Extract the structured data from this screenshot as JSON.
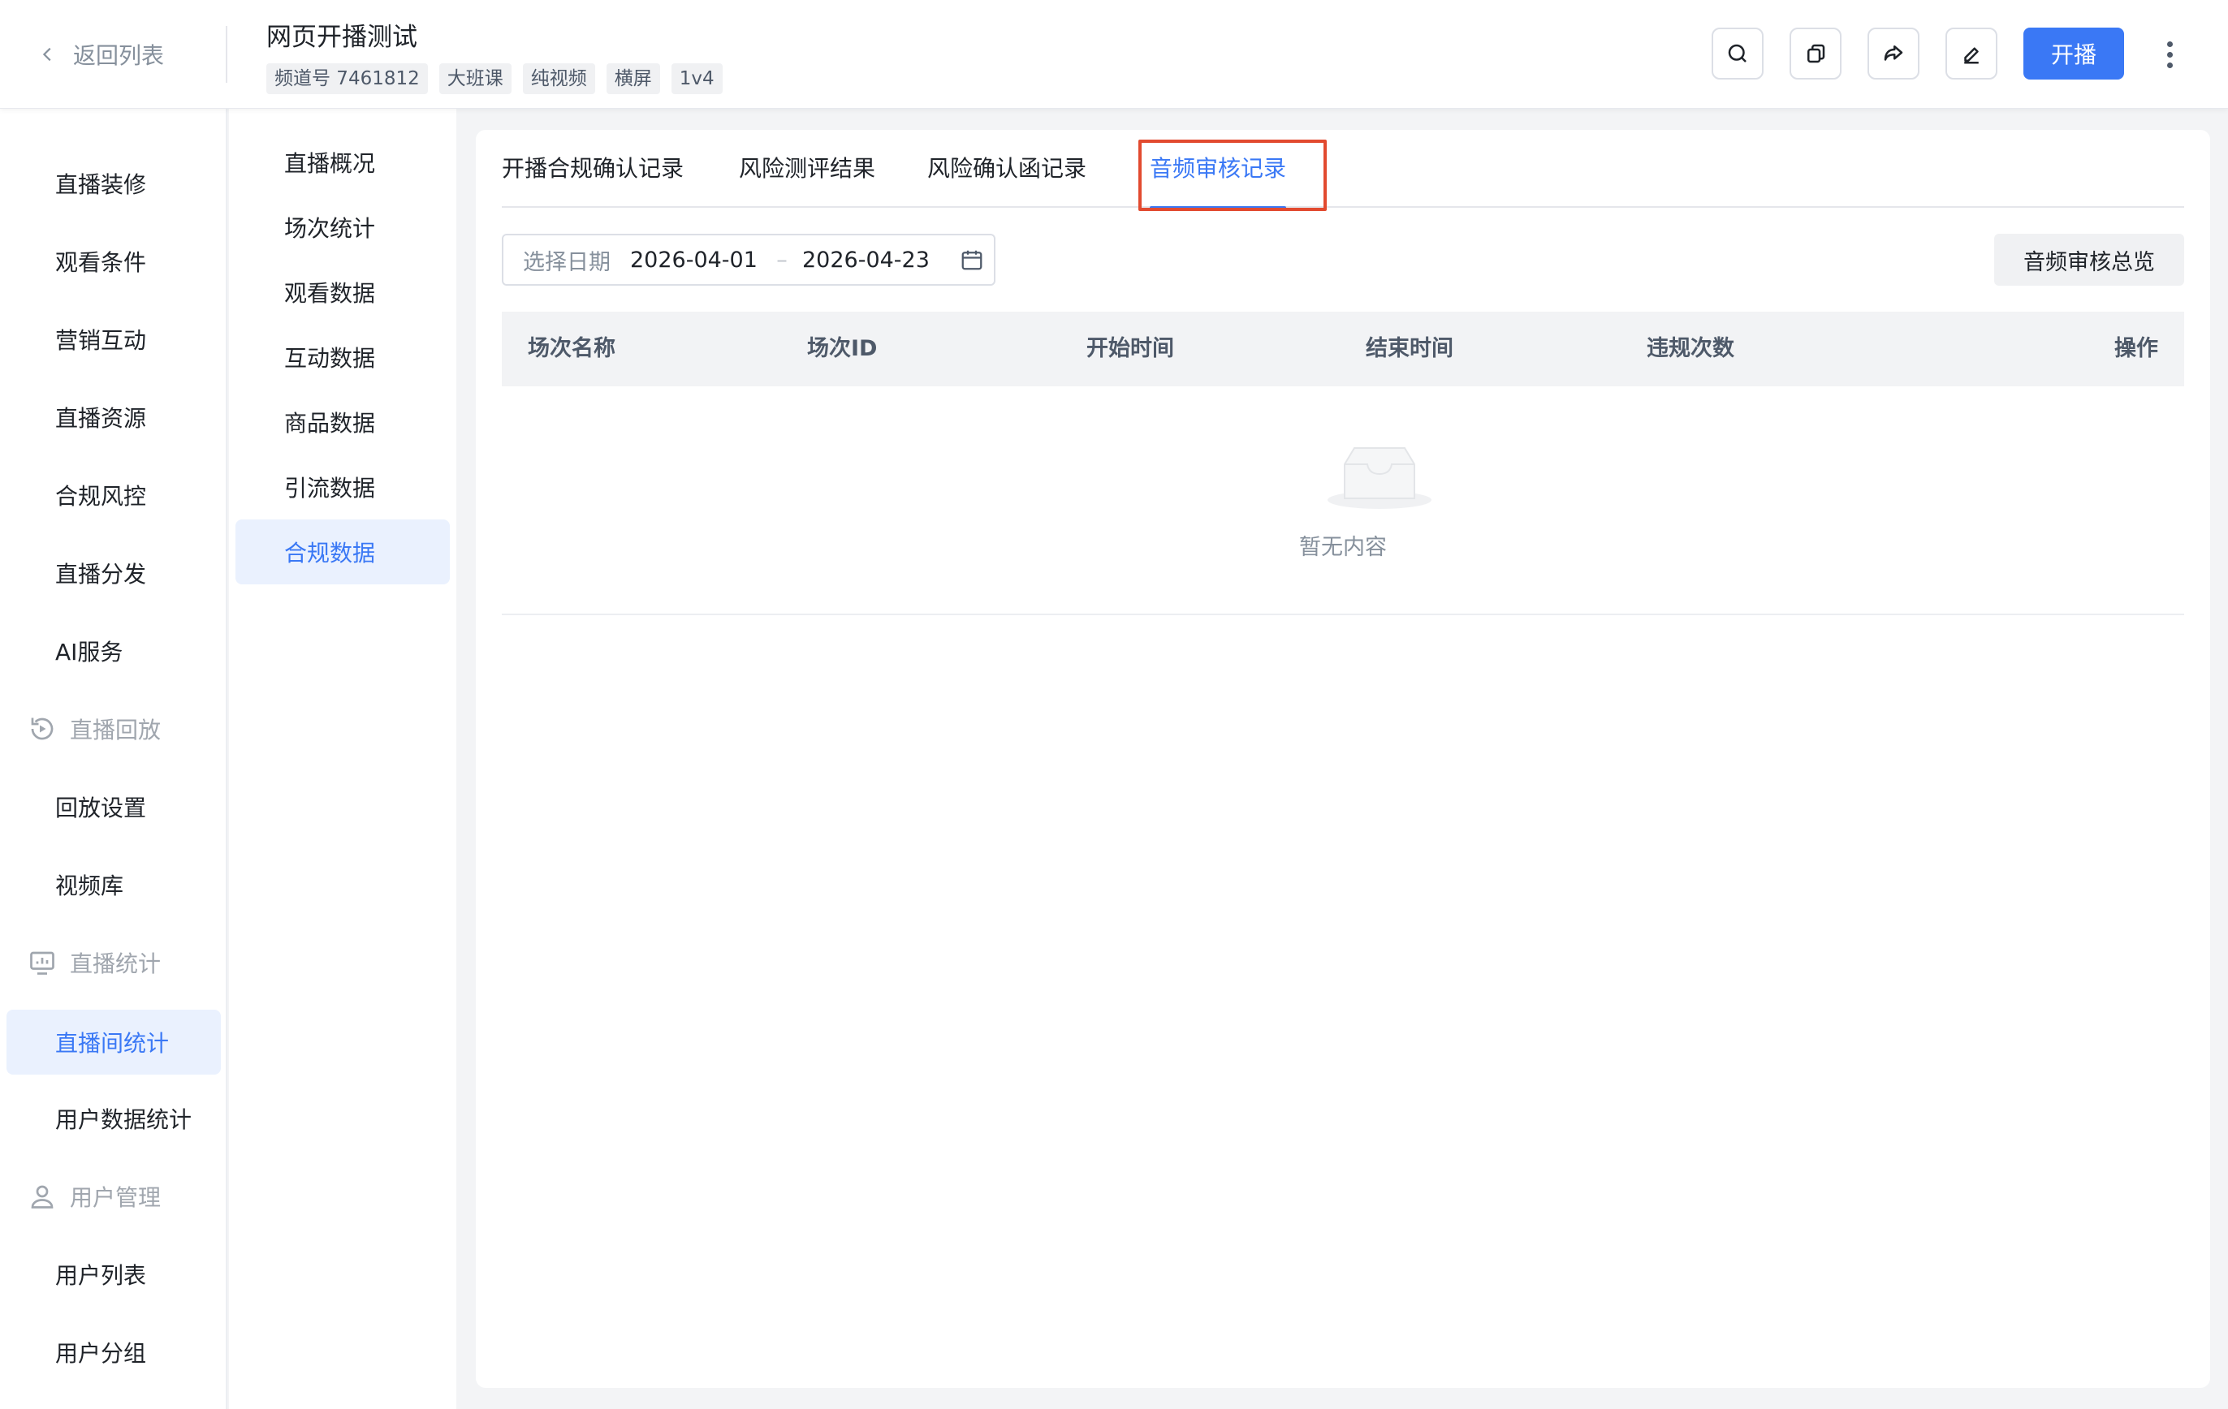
{
  "header": {
    "back_label": "返回列表",
    "title": "网页开播测试",
    "tags": [
      "频道号 7461812",
      "大班课",
      "纯视频",
      "横屏",
      "1v4"
    ],
    "start_label": "开播",
    "accent_color": "#3a78f5"
  },
  "sidebar": {
    "items": [
      {
        "label": "直播装修"
      },
      {
        "label": "观看条件"
      },
      {
        "label": "营销互动"
      },
      {
        "label": "直播资源"
      },
      {
        "label": "合规风控"
      },
      {
        "label": "直播分发"
      },
      {
        "label": "AI服务"
      }
    ],
    "group_replay": {
      "label": "直播回放",
      "icon": "replay-icon"
    },
    "replay_items": [
      {
        "label": "回放设置"
      },
      {
        "label": "视频库"
      }
    ],
    "group_stats": {
      "label": "直播统计",
      "icon": "monitor-chart-icon"
    },
    "stats_items": [
      {
        "label": "直播间统计",
        "active": true
      },
      {
        "label": "用户数据统计"
      }
    ],
    "group_users": {
      "label": "用户管理",
      "icon": "user-icon"
    },
    "user_items": [
      {
        "label": "用户列表"
      },
      {
        "label": "用户分组"
      }
    ]
  },
  "subnav": {
    "items": [
      {
        "label": "直播概况"
      },
      {
        "label": "场次统计"
      },
      {
        "label": "观看数据"
      },
      {
        "label": "互动数据"
      },
      {
        "label": "商品数据"
      },
      {
        "label": "引流数据"
      },
      {
        "label": "合规数据",
        "active": true
      }
    ]
  },
  "tabs": [
    {
      "label": "开播合规确认记录"
    },
    {
      "label": "风险测评结果"
    },
    {
      "label": "风险确认函记录"
    },
    {
      "label": "音频审核记录",
      "active": true
    }
  ],
  "filter": {
    "date_label": "选择日期",
    "start_date": "2026-04-01",
    "separator": "–",
    "end_date": "2026-04-23"
  },
  "overview_button": "音频审核总览",
  "table": {
    "columns": [
      "场次名称",
      "场次ID",
      "开始时间",
      "结束时间",
      "违规次数",
      "操作"
    ],
    "rows": [],
    "empty_text": "暂无内容"
  }
}
